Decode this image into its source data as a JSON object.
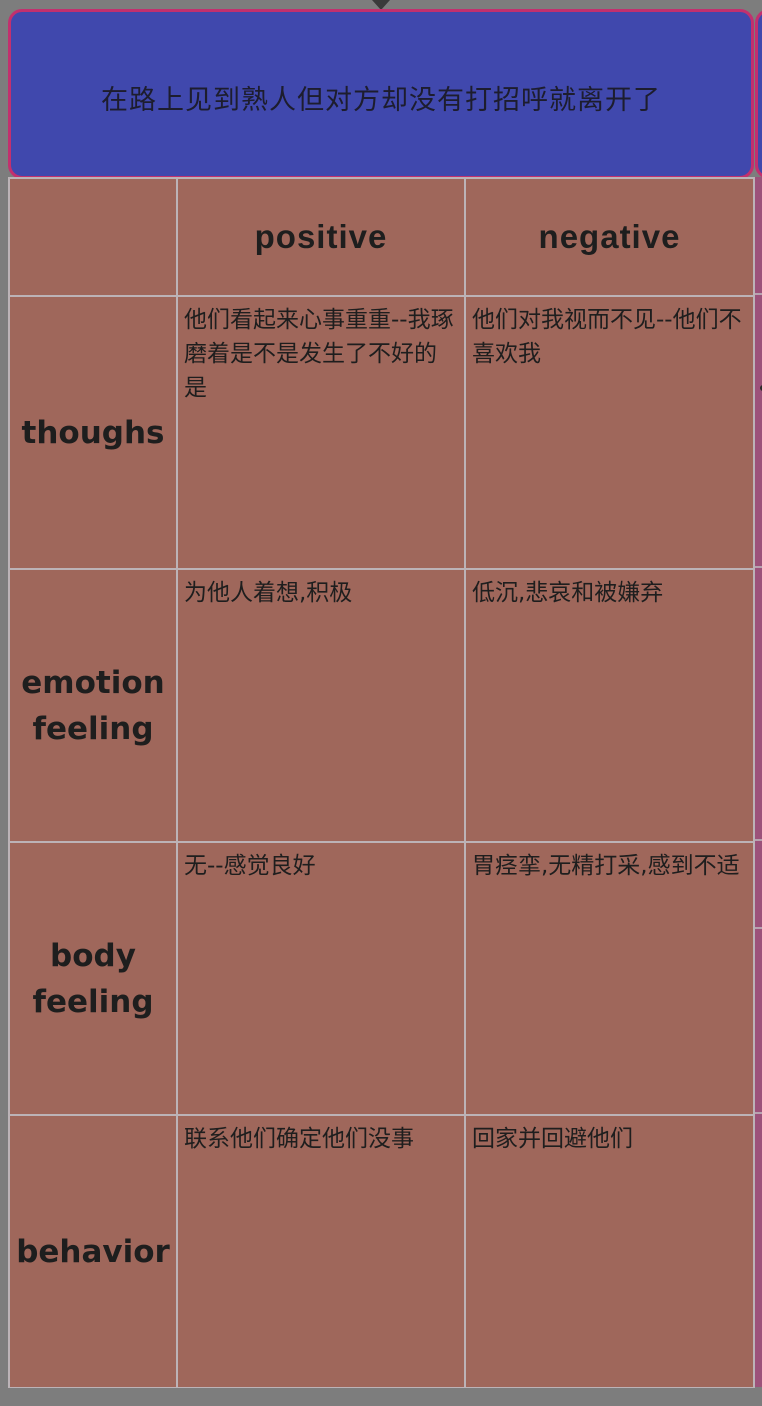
{
  "header": {
    "title": "在路上见到熟人但对方却没有打招呼就离开了"
  },
  "table": {
    "columns": [
      "",
      "positive",
      "negative"
    ],
    "rows": [
      {
        "label": "thoughs",
        "positive": "他们看起来心事重重--我琢磨着是不是发生了不好的是",
        "negative": "他们对我视而不见--他们不喜欢我"
      },
      {
        "label": "emotion feeling",
        "positive": "为他人着想,积极",
        "negative": "低沉,悲哀和被嫌弃"
      },
      {
        "label": "body feeling",
        "positive": "无--感觉良好",
        "negative": "胃痉挛,无精打采,感到不适"
      },
      {
        "label": "behavior",
        "positive": "联系他们确定他们没事",
        "negative": "回家并回避他们"
      }
    ]
  },
  "colors": {
    "header_bg": "#4048ad",
    "header_border": "#c2306e",
    "cell_bg": "#9f675b",
    "grid_line": "#bcb3b7",
    "canvas_bg": "#7d7d7d"
  }
}
